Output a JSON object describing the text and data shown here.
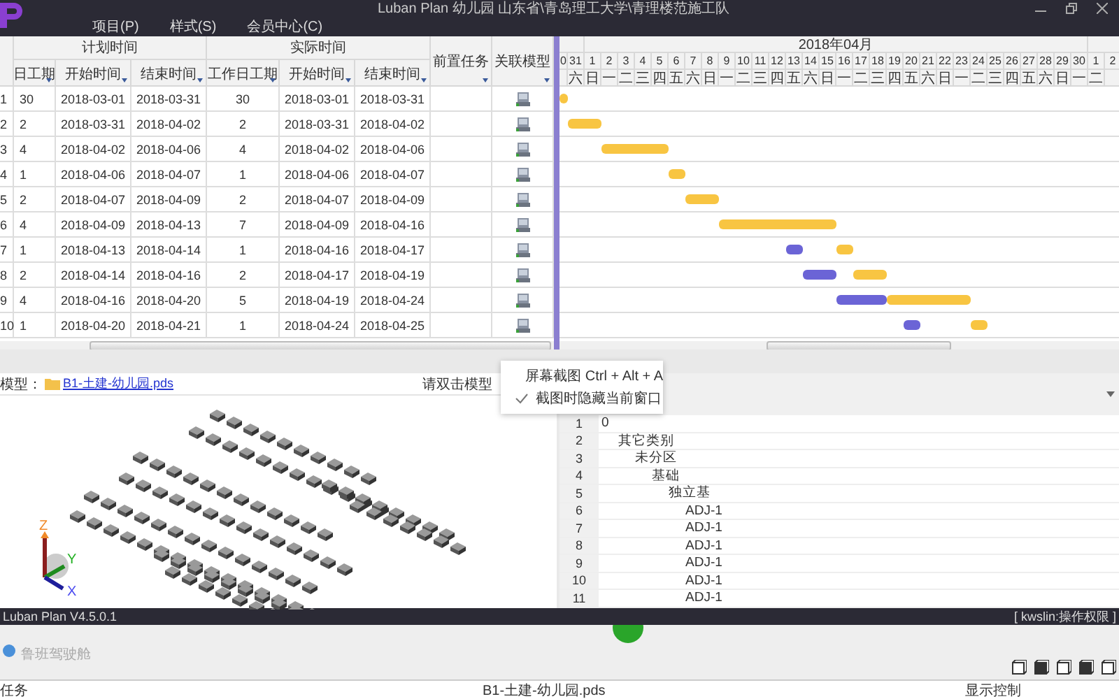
{
  "window": {
    "title": "Luban Plan 幼儿园 山东省\\青岛理工大学\\青理楼范施工队"
  },
  "menu": [
    {
      "label": "项目(P)"
    },
    {
      "label": "样式(S)"
    },
    {
      "label": "会员中心(C)"
    }
  ],
  "task_table": {
    "groups": [
      {
        "label": "计划时间",
        "columns": [
          "日工期",
          "开始时间",
          "结束时间"
        ]
      },
      {
        "label": "实际时间",
        "columns": [
          "工作日工期",
          "开始时间",
          "结束时间"
        ]
      }
    ],
    "columns": [
      "前置任务",
      "关联模型"
    ],
    "rows": [
      {
        "num": "1",
        "plan_days": "30",
        "plan_start": "2018-03-01",
        "plan_end": "2018-03-31",
        "actual_days": "30",
        "actual_start": "2018-03-01",
        "actual_end": "2018-03-31"
      },
      {
        "num": "2",
        "plan_days": "2",
        "plan_start": "2018-03-31",
        "plan_end": "2018-04-02",
        "actual_days": "2",
        "actual_start": "2018-03-31",
        "actual_end": "2018-04-02"
      },
      {
        "num": "3",
        "plan_days": "4",
        "plan_start": "2018-04-02",
        "plan_end": "2018-04-06",
        "actual_days": "4",
        "actual_start": "2018-04-02",
        "actual_end": "2018-04-06"
      },
      {
        "num": "4",
        "plan_days": "1",
        "plan_start": "2018-04-06",
        "plan_end": "2018-04-07",
        "actual_days": "1",
        "actual_start": "2018-04-06",
        "actual_end": "2018-04-07"
      },
      {
        "num": "5",
        "plan_days": "2",
        "plan_start": "2018-04-07",
        "plan_end": "2018-04-09",
        "actual_days": "2",
        "actual_start": "2018-04-07",
        "actual_end": "2018-04-09"
      },
      {
        "num": "6",
        "plan_days": "4",
        "plan_start": "2018-04-09",
        "plan_end": "2018-04-13",
        "actual_days": "7",
        "actual_start": "2018-04-09",
        "actual_end": "2018-04-16"
      },
      {
        "num": "7",
        "plan_days": "1",
        "plan_start": "2018-04-13",
        "plan_end": "2018-04-14",
        "actual_days": "1",
        "actual_start": "2018-04-16",
        "actual_end": "2018-04-17"
      },
      {
        "num": "8",
        "plan_days": "2",
        "plan_start": "2018-04-14",
        "plan_end": "2018-04-16",
        "actual_days": "2",
        "actual_start": "2018-04-17",
        "actual_end": "2018-04-19"
      },
      {
        "num": "9",
        "plan_days": "4",
        "plan_start": "2018-04-16",
        "plan_end": "2018-04-20",
        "actual_days": "5",
        "actual_start": "2018-04-19",
        "actual_end": "2018-04-24"
      },
      {
        "num": "10",
        "plan_days": "1",
        "plan_start": "2018-04-20",
        "plan_end": "2018-04-21",
        "actual_days": "1",
        "actual_start": "2018-04-24",
        "actual_end": "2018-04-25"
      }
    ]
  },
  "gantt": {
    "months": [
      {
        "days": [
          {
            "day": "0"
          },
          {
            "day": "31",
            "weekday": "六"
          }
        ]
      },
      {
        "label": "2018年04月",
        "days": [
          {
            "day": "1",
            "weekday": "日"
          },
          {
            "day": "2",
            "weekday": "一"
          },
          {
            "day": "3",
            "weekday": "二"
          },
          {
            "day": "4",
            "weekday": "三"
          },
          {
            "day": "5",
            "weekday": "四"
          },
          {
            "day": "6",
            "weekday": "五"
          },
          {
            "day": "7",
            "weekday": "六"
          },
          {
            "day": "8",
            "weekday": "日"
          },
          {
            "day": "9",
            "weekday": "一"
          },
          {
            "day": "10",
            "weekday": "二"
          },
          {
            "day": "11",
            "weekday": "三"
          },
          {
            "day": "12",
            "weekday": "四"
          },
          {
            "day": "13",
            "weekday": "五"
          },
          {
            "day": "14",
            "weekday": "六"
          },
          {
            "day": "15",
            "weekday": "日"
          },
          {
            "day": "16",
            "weekday": "一"
          },
          {
            "day": "17",
            "weekday": "二"
          },
          {
            "day": "18",
            "weekday": "三"
          },
          {
            "day": "19",
            "weekday": "四"
          },
          {
            "day": "20",
            "weekday": "五"
          },
          {
            "day": "21",
            "weekday": "六"
          },
          {
            "day": "22",
            "weekday": "日"
          },
          {
            "day": "23",
            "weekday": "一"
          },
          {
            "day": "24",
            "weekday": "二"
          },
          {
            "day": "25",
            "weekday": "三"
          },
          {
            "day": "26",
            "weekday": "四"
          },
          {
            "day": "27",
            "weekday": "五"
          },
          {
            "day": "28",
            "weekday": "六"
          },
          {
            "day": "29",
            "weekday": "日"
          },
          {
            "day": "30",
            "weekday": "一"
          }
        ]
      },
      {
        "days": [
          {
            "day": "1",
            "weekday": "二"
          },
          {
            "day": "2"
          }
        ]
      }
    ]
  },
  "model_view": {
    "label": "模型：",
    "file": "B1-土建-幼儿园.pds",
    "hint": "请双击模型",
    "axes": [
      "Z",
      "Y",
      "X"
    ]
  },
  "tree": [
    {
      "num": "1",
      "name": "0",
      "children": [
        {
          "num": "2",
          "name": "其它类别",
          "children": [
            {
              "num": "3",
              "name": "未分区",
              "children": [
                {
                  "num": "4",
                  "name": "基础",
                  "children": [
                    {
                      "num": "5",
                      "name": "独立基",
                      "children": [
                        {
                          "num": "6",
                          "name": "ADJ-1"
                        },
                        {
                          "num": "7",
                          "name": "ADJ-1"
                        },
                        {
                          "num": "8",
                          "name": "ADJ-1"
                        },
                        {
                          "num": "9",
                          "name": "ADJ-1"
                        },
                        {
                          "num": "10",
                          "name": "ADJ-1"
                        },
                        {
                          "num": "11",
                          "name": "ADJ-1"
                        }
                      ]
                    }
                  ]
                }
              ]
            }
          ]
        }
      ]
    }
  ],
  "context_menu": [
    {
      "label": "屏幕截图 Ctrl + Alt + A",
      "checked": false
    },
    {
      "label": "截图时隐藏当前窗口",
      "checked": true
    }
  ],
  "status_bar": {
    "version": "Luban Plan V4.5.0.1",
    "user": "[ kwslin:操作权限 ]"
  },
  "background_window": {
    "title": "鲁班驾驶舱",
    "tabs": [
      "任务",
      "B1-土建-幼儿园.pds",
      "显示控制"
    ]
  }
}
